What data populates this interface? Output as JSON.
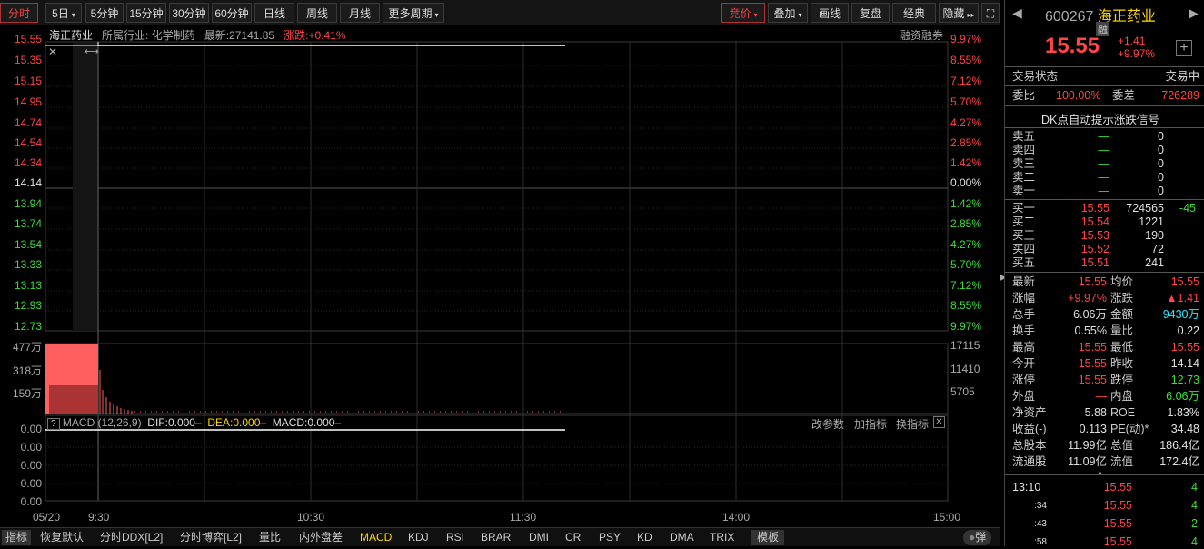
{
  "toolbar": {
    "periods": [
      "分时",
      "5日",
      "5分钟",
      "15分钟",
      "30分钟",
      "60分钟",
      "日线",
      "周线",
      "月线",
      "更多周期"
    ],
    "active_period": "分时",
    "right_buttons": [
      "竞价",
      "叠加",
      "画线",
      "复盘",
      "经典",
      "隐藏"
    ]
  },
  "stock_info_bar": {
    "name": "海正药业",
    "industry": "所属行业: 化学制药",
    "latest": "最新:27141.85",
    "change": "涨跌:+0.41%",
    "margin_label": "融资融券"
  },
  "price_axis_left": [
    "15.55",
    "15.35",
    "15.15",
    "14.95",
    "14.74",
    "14.54",
    "14.34",
    "14.14",
    "13.94",
    "13.74",
    "13.54",
    "13.33",
    "13.13",
    "12.93",
    "12.73"
  ],
  "price_axis_right": [
    "9.97%",
    "8.55%",
    "7.12%",
    "5.70%",
    "4.27%",
    "2.85%",
    "1.42%",
    "0.00%",
    "1.42%",
    "2.85%",
    "4.27%",
    "5.70%",
    "7.12%",
    "8.55%",
    "9.97%"
  ],
  "volume_axis_left": [
    "477万",
    "318万",
    "159万"
  ],
  "volume_axis_right": [
    "17115",
    "11410",
    "5705"
  ],
  "macd": {
    "help": "?",
    "label": "MACD (12,26,9)",
    "dif": "DIF:0.000–",
    "dea": "DEA:0.000–",
    "macd": "MACD:0.000–",
    "actions": [
      "改参数",
      "加指标",
      "换指标"
    ],
    "axis": [
      "0.00",
      "0.00",
      "0.00",
      "0.00",
      "0.00"
    ]
  },
  "time_axis": [
    "05/20",
    "9:30",
    "10:30",
    "11:30",
    "14:00",
    "15:00"
  ],
  "bottom_tabs": [
    "指标",
    "恢复默认",
    "分时DDX[L2]",
    "分时博弈[L2]",
    "量比",
    "内外盘差",
    "MACD",
    "KDJ",
    "RSI",
    "BRAR",
    "DMI",
    "CR",
    "PSY",
    "KD",
    "DMA",
    "TRIX",
    "模板"
  ],
  "active_tab": "MACD",
  "popup_label": "弹",
  "quote": {
    "code": "600267",
    "name": "海正药业",
    "margin_badge": "融",
    "price": "15.55",
    "change": "+1.41",
    "change_pct": "+9.97%",
    "status_label": "交易状态",
    "status": "交易中",
    "ratio_label": "委比",
    "ratio": "100.00%",
    "diff_label": "委差",
    "diff": "726289",
    "signal_link": "DK点自动提示涨跌信号"
  },
  "asks": [
    {
      "label": "卖五",
      "price": "—",
      "vol": "0"
    },
    {
      "label": "卖四",
      "price": "—",
      "vol": "0"
    },
    {
      "label": "卖三",
      "price": "—",
      "vol": "0"
    },
    {
      "label": "卖二",
      "price": "—",
      "vol": "0"
    },
    {
      "label": "卖一",
      "price": "—",
      "vol": "0"
    }
  ],
  "bids": [
    {
      "label": "买一",
      "price": "15.55",
      "vol": "724565",
      "chg": "-45"
    },
    {
      "label": "买二",
      "price": "15.54",
      "vol": "1221",
      "chg": ""
    },
    {
      "label": "买三",
      "price": "15.53",
      "vol": "190",
      "chg": ""
    },
    {
      "label": "买四",
      "price": "15.52",
      "vol": "72",
      "chg": ""
    },
    {
      "label": "买五",
      "price": "15.51",
      "vol": "241",
      "chg": ""
    }
  ],
  "stats": [
    {
      "l1": "最新",
      "v1": "15.55",
      "c1": "red",
      "l2": "均价",
      "v2": "15.55",
      "c2": "red"
    },
    {
      "l1": "涨幅",
      "v1": "+9.97%",
      "c1": "red",
      "l2": "涨跌",
      "v2": "▲1.41",
      "c2": "red"
    },
    {
      "l1": "总手",
      "v1": "6.06万",
      "c1": "wht",
      "l2": "金额",
      "v2": "9430万",
      "c2": "cyan"
    },
    {
      "l1": "换手",
      "v1": "0.55%",
      "c1": "wht",
      "l2": "量比",
      "v2": "0.22",
      "c2": "wht"
    },
    {
      "l1": "最高",
      "v1": "15.55",
      "c1": "red",
      "l2": "最低",
      "v2": "15.55",
      "c2": "red"
    },
    {
      "l1": "今开",
      "v1": "15.55",
      "c1": "red",
      "l2": "昨收",
      "v2": "14.14",
      "c2": "wht"
    },
    {
      "l1": "涨停",
      "v1": "15.55",
      "c1": "red",
      "l2": "跌停",
      "v2": "12.73",
      "c2": "grn"
    },
    {
      "l1": "外盘",
      "v1": "—",
      "c1": "red",
      "l2": "内盘",
      "v2": "6.06万",
      "c2": "grn"
    },
    {
      "l1": "净资产",
      "v1": "5.88",
      "c1": "wht",
      "l2": "ROE",
      "v2": "1.83%",
      "c2": "wht"
    },
    {
      "l1": "收益(-)",
      "v1": "0.113",
      "c1": "wht",
      "l2": "PE(动)*",
      "v2": "34.48",
      "c2": "wht"
    },
    {
      "l1": "总股本",
      "v1": "11.99亿",
      "c1": "wht",
      "l2": "总值",
      "v2": "186.4亿",
      "c2": "wht"
    },
    {
      "l1": "流通股",
      "v1": "11.09亿",
      "c1": "wht",
      "l2": "流值",
      "v2": "172.4亿",
      "c2": "wht"
    }
  ],
  "ticks": [
    {
      "time": "13:10",
      "price": "15.55",
      "vol": "4"
    },
    {
      "time": ":34",
      "price": "15.55",
      "vol": "4"
    },
    {
      "time": ":43",
      "price": "15.55",
      "vol": "2"
    },
    {
      "time": ":58",
      "price": "15.55",
      "vol": "4"
    }
  ],
  "colors": {
    "up": "#ff4545",
    "down": "#3fdc3f",
    "volume_fill": "#ff5f5f"
  }
}
